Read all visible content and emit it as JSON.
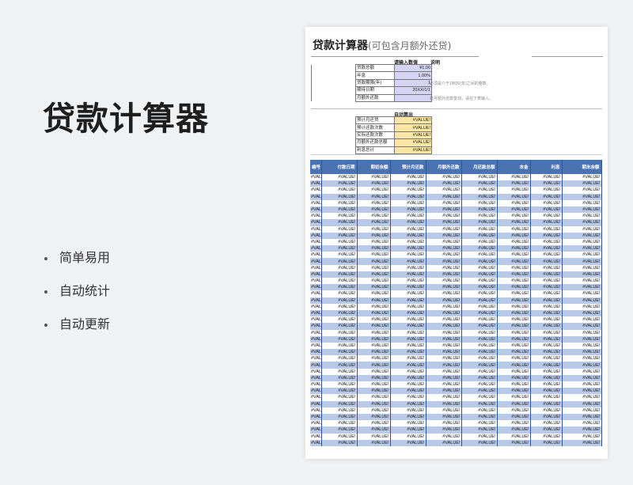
{
  "promo": {
    "title": "贷款计算器",
    "features": [
      "简单易用",
      "自动统计",
      "自动更新"
    ]
  },
  "sheet": {
    "title": "贷款计算器",
    "subtitle": "(可包含月额外还贷)",
    "input_header": "请输入数值",
    "notes_header": "说明",
    "inputs": [
      {
        "label": "贷款总额",
        "value": "¥1.00"
      },
      {
        "label": "年息",
        "value": "1.00%"
      },
      {
        "label": "贷款期限(年)",
        "value": "1"
      },
      {
        "label": "期待日期",
        "value": "20XX/1/1"
      },
      {
        "label": "月额外还款",
        "value": ""
      }
    ],
    "notes": [
      "",
      "",
      "必须是介于1到30(年)之间的整数。",
      "",
      "若月额外还款变动，请在下表输入。"
    ],
    "output_header": "自动算出",
    "outputs": [
      {
        "label": "预计月还贷",
        "value": "#VALUE!"
      },
      {
        "label": "预计还款次数",
        "value": "#VALUE!"
      },
      {
        "label": "实际还款次数",
        "value": "#VALUE!"
      },
      {
        "label": "月额外还款总额",
        "value": "#VALUE!"
      },
      {
        "label": "利息总计",
        "value": "#VALUE!"
      }
    ],
    "columns": [
      "编号",
      "付款日期",
      "期初余额",
      "预计月还款",
      "月额外还款",
      "月还款总额",
      "本金",
      "利息",
      "期末余额"
    ],
    "cell_value": "#VALUE!",
    "row_count": 42
  }
}
